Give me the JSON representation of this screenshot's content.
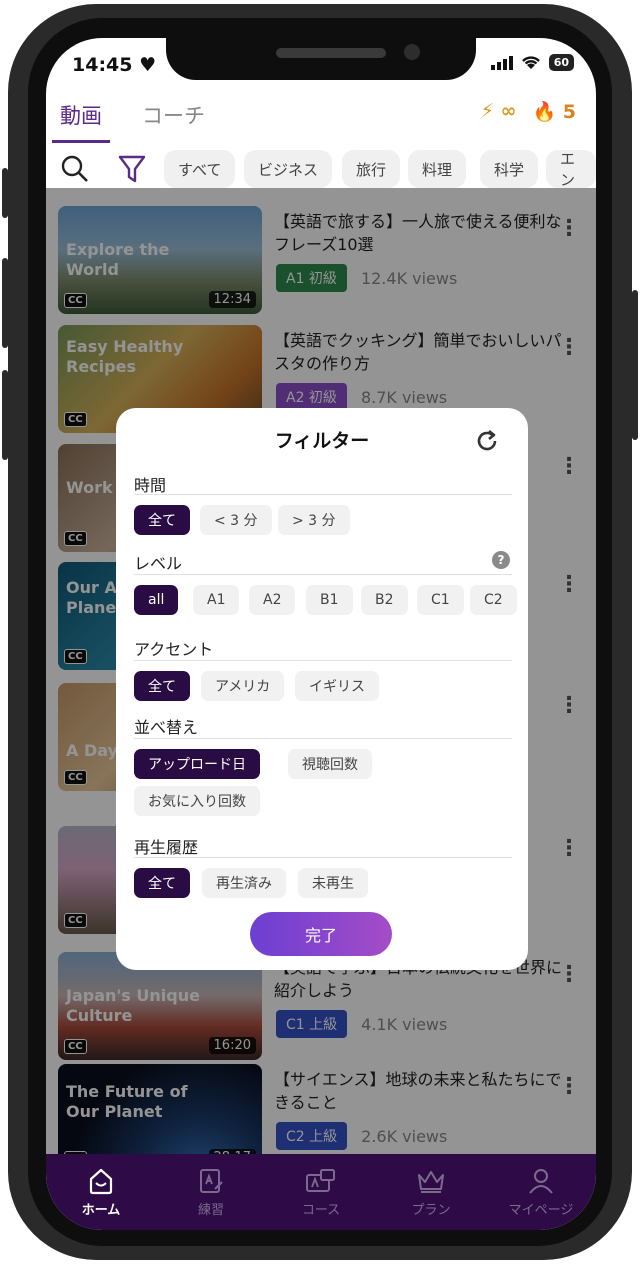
{
  "status_bar": {
    "time": "14:45",
    "battery": "60"
  },
  "header": {
    "tabs": [
      {
        "label": "動画",
        "active": true
      },
      {
        "label": "コーチ",
        "active": false
      }
    ],
    "energy": "∞",
    "streak": "5"
  },
  "category_chips": [
    "すべて",
    "ビジネス",
    "旅行",
    "料理",
    "科学",
    "エン"
  ],
  "videos": [
    {
      "thumb_text": "Explore the World",
      "duration": "12:34",
      "title": "【英語で旅する】一人旅で使える便利なフレーズ10選",
      "level": "A1 初級",
      "level_color": "#2e8a4c",
      "views": "12.4K views"
    },
    {
      "thumb_text": "Easy Healthy Recipes",
      "duration": "",
      "title": "【英語でクッキング】簡単でおいしいパスタの作り方",
      "level": "A2 初級",
      "level_color": "#8a4fc9",
      "views": "8.7K views"
    },
    {
      "thumb_text": "Work Smarte",
      "duration": "",
      "title": "",
      "level": "",
      "level_color": "",
      "views": ""
    },
    {
      "thumb_text": "Our Amazi Planet",
      "duration": "",
      "title": "",
      "level": "",
      "level_color": "",
      "views": ""
    },
    {
      "thumb_text": "A Day in My L",
      "duration": "",
      "title": "",
      "level": "",
      "level_color": "",
      "views": ""
    },
    {
      "thumb_text": "",
      "duration": "",
      "title": "",
      "level": "",
      "level_color": "",
      "views": ""
    },
    {
      "thumb_text": "Japan's Unique Culture",
      "duration": "16:20",
      "title": "【英語で学ぶ】日本の伝統文化を世界に紹介しよう",
      "level": "C1 上級",
      "level_color": "#3452c8",
      "views": "4.1K views"
    },
    {
      "thumb_text": "The Future of Our Planet",
      "duration": "28:17",
      "title": "【サイエンス】地球の未来と私たちにできること",
      "level": "C2 上級",
      "level_color": "#3452c8",
      "views": "2.6K views"
    }
  ],
  "cc_label": "CC",
  "filter_modal": {
    "title": "フィルター",
    "sections": {
      "duration": {
        "label": "時間",
        "options": [
          "全て",
          "< 3 分",
          "> 3 分"
        ],
        "selected": "全て"
      },
      "level": {
        "label": "レベル",
        "help": "?",
        "options": [
          "all",
          "A1",
          "A2",
          "B1",
          "B2",
          "C1",
          "C2"
        ],
        "selected": "all"
      },
      "accent": {
        "label": "アクセント",
        "options": [
          "全て",
          "アメリカ",
          "イギリス"
        ],
        "selected": "全て"
      },
      "sort": {
        "label": "並べ替え",
        "options": [
          "アップロード日",
          "視聴回数",
          "お気に入り回数"
        ],
        "selected": "アップロード日"
      },
      "history": {
        "label": "再生履歴",
        "options": [
          "全て",
          "再生済み",
          "未再生"
        ],
        "selected": "全て"
      }
    },
    "done_label": "完了"
  },
  "bottom_nav": [
    {
      "label": "ホーム",
      "icon": "home-icon",
      "active": true
    },
    {
      "label": "練習",
      "icon": "practice-icon",
      "active": false
    },
    {
      "label": "コース",
      "icon": "course-icon",
      "active": false
    },
    {
      "label": "プラン",
      "icon": "crown-icon",
      "active": false
    },
    {
      "label": "マイページ",
      "icon": "person-icon",
      "active": false
    }
  ],
  "colors": {
    "accent": "#5b2a86",
    "selected_chip": "#2a0c45",
    "nav_bg": "#2e0b47"
  }
}
